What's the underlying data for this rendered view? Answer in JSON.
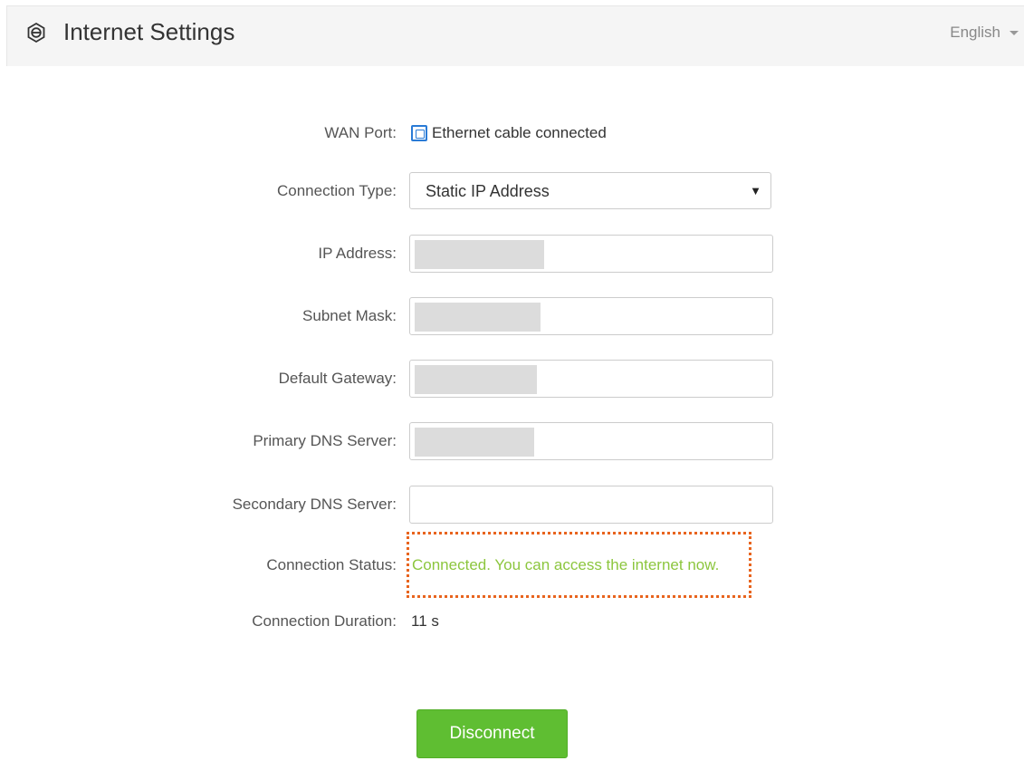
{
  "header": {
    "title": "Internet Settings",
    "title_icon": "ie-settings-icon",
    "language": "English"
  },
  "form": {
    "wan_port": {
      "label": "WAN Port:",
      "icon": "ethernet-port-icon",
      "status": "Ethernet cable connected",
      "icon_color": "#2a7bd6"
    },
    "connection_type": {
      "label": "Connection Type:",
      "value": "Static IP Address"
    },
    "ip_address": {
      "label": "IP Address:"
    },
    "subnet_mask": {
      "label": "Subnet Mask:"
    },
    "default_gateway": {
      "label": "Default Gateway:"
    },
    "primary_dns": {
      "label": "Primary DNS Server:"
    },
    "secondary_dns": {
      "label": "Secondary DNS Server:",
      "value": ""
    },
    "connection_status": {
      "label": "Connection Status:",
      "value": "Connected. You can access the internet now.",
      "color": "#8cc63e",
      "highlight_color": "#e8641e"
    },
    "connection_duration": {
      "label": "Connection Duration:",
      "value": "11 s"
    }
  },
  "actions": {
    "disconnect_label": "Disconnect",
    "disconnect_color": "#5fbe32"
  }
}
